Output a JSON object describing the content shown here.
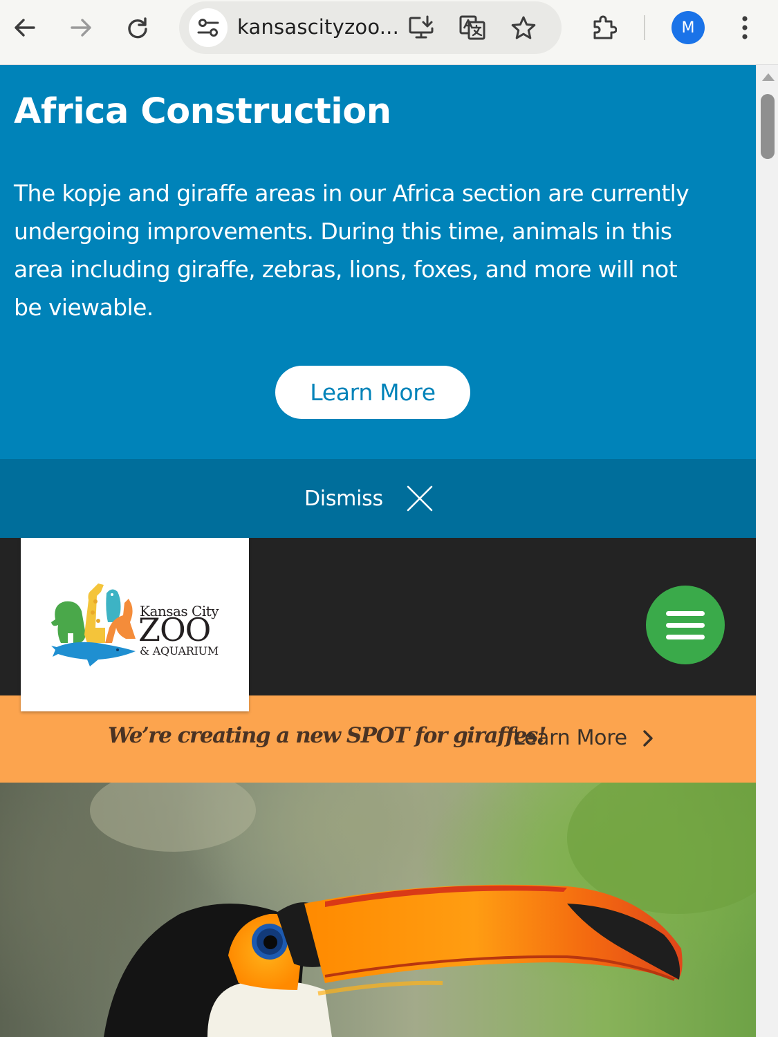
{
  "browser": {
    "url": "kansascityzoo...",
    "profile_initial": "M",
    "icons": {
      "back": "arrow-left-icon",
      "forward": "arrow-right-icon",
      "reload": "reload-icon",
      "site_info": "tune-icon",
      "install": "install-app-icon",
      "translate": "translate-icon",
      "bookmark": "star-icon",
      "extensions": "puzzle-icon",
      "menu": "kebab-menu-icon"
    }
  },
  "alert": {
    "title": "Africa Construction",
    "body": "The kopje and giraffe areas in our Africa section are currently undergoing improvements. During this time, animals in this area including giraffe, zebras, lions, foxes, and more will not be viewable.",
    "button_label": "Learn More",
    "dismiss_label": "Dismiss"
  },
  "header": {
    "logo": {
      "line1": "Kansas City",
      "line2": "ZOO",
      "line3": "& AQUARIUM"
    },
    "menu_icon": "hamburger-icon"
  },
  "promo": {
    "text": "We’re creating a new SPOT for giraffes!",
    "link_label": "Learn More"
  },
  "hero": {
    "image": "toucan-photo"
  },
  "colors": {
    "alert_bg": "#0083b9",
    "dismiss_bg": "#006e9b",
    "header_bg": "#232323",
    "menu_button": "#3aaa4a",
    "promo_bg": "#fca44e",
    "avatar": "#1a73e8"
  }
}
